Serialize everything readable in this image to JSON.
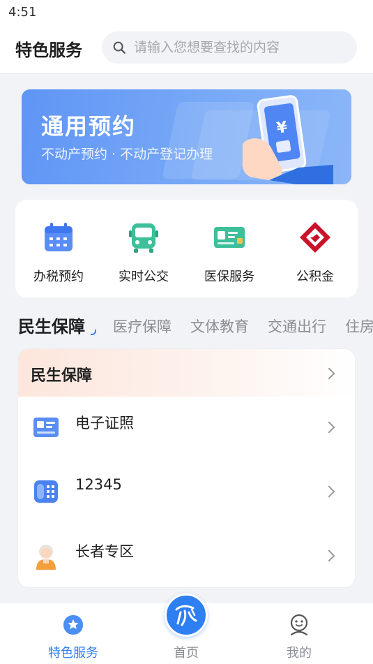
{
  "status_bar": {
    "time": "4:51"
  },
  "header": {
    "title": "特色服务",
    "search": {
      "placeholder": "请输入您想要查找的内容",
      "icon": "search-icon"
    }
  },
  "banner": {
    "title": "通用预约",
    "subtitle": "不动产预约 · 不动产登记办理",
    "currency_symbol": "¥"
  },
  "quick_services": [
    {
      "label": "办税预约",
      "icon": "calendar-icon"
    },
    {
      "label": "实时公交",
      "icon": "bus-icon"
    },
    {
      "label": "医保服务",
      "icon": "medical-card-icon"
    },
    {
      "label": "公积金",
      "icon": "housing-fund-logo-icon"
    }
  ],
  "tabs": {
    "active": "民生保障",
    "items": [
      "民生保障",
      "医疗保障",
      "文体教育",
      "交通出行",
      "住房"
    ]
  },
  "section": {
    "title": "民生保障",
    "items": [
      {
        "label": "电子证照",
        "icon": "id-card-icon"
      },
      {
        "label": "12345",
        "icon": "phone-hotline-icon"
      },
      {
        "label": "长者专区",
        "icon": "elder-icon"
      }
    ]
  },
  "bottom_nav": {
    "items": [
      {
        "label": "特色服务",
        "active": true,
        "icon": "star-badge-icon"
      },
      {
        "label": "首页",
        "active": false,
        "icon": "home-logo-icon"
      },
      {
        "label": "我的",
        "active": false,
        "icon": "profile-icon"
      }
    ]
  },
  "colors": {
    "accent": "#2f7cf0",
    "banner": "#6b9ef6",
    "section_header": "#fde6dc"
  }
}
